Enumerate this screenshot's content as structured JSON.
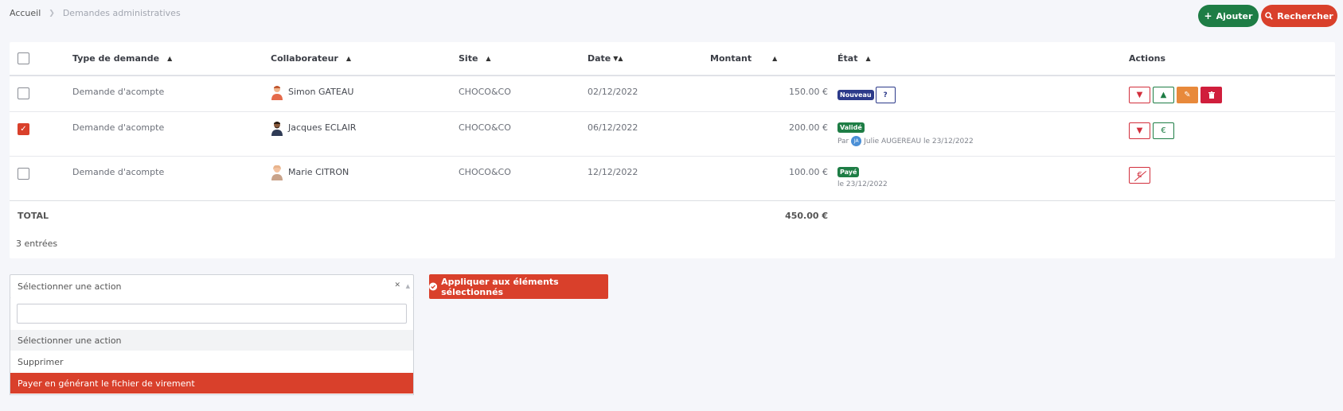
{
  "breadcrumb": {
    "home": "Accueil",
    "current": "Demandes administratives"
  },
  "toolbar": {
    "add_label": "Ajouter",
    "search_label": "Rechercher"
  },
  "table": {
    "headers": {
      "type": "Type de demande",
      "collaborateur": "Collaborateur",
      "site": "Site",
      "date": "Date",
      "montant": "Montant",
      "etat": "État",
      "actions": "Actions"
    },
    "rows": [
      {
        "checked": false,
        "type": "Demande d'acompte",
        "collaborateur": "Simon GATEAU",
        "site": "CHOCO&CO",
        "date": "02/12/2022",
        "montant": "150.00 €",
        "etat_badge": "Nouveau",
        "etat_button": "?",
        "actions": [
          "thumbs-down-icon",
          "thumbs-up-icon",
          "edit-icon",
          "trash-icon"
        ]
      },
      {
        "checked": true,
        "type": "Demande d'acompte",
        "collaborateur": "Jacques ECLAIR",
        "site": "CHOCO&CO",
        "date": "06/12/2022",
        "montant": "200.00 €",
        "etat_badge": "Validé",
        "etat_sub_prefix": "Par",
        "etat_sub_initials": "JA",
        "etat_sub_text": "Julie AUGEREAU le 23/12/2022",
        "pay_label": "€",
        "actions": [
          "thumbs-down-icon",
          "euro-icon"
        ]
      },
      {
        "checked": false,
        "type": "Demande d'acompte",
        "collaborateur": "Marie CITRON",
        "site": "CHOCO&CO",
        "date": "12/12/2022",
        "montant": "100.00 €",
        "etat_badge": "Payé",
        "etat_sub_text": "le 23/12/2022",
        "unpay_label": "€",
        "actions": [
          "euro-strike-icon"
        ]
      }
    ],
    "total_label": "TOTAL",
    "total_value": "450.00 €",
    "entries": "3 entrées"
  },
  "bulk": {
    "select_value": "Sélectionner une action",
    "options": [
      "Sélectionner une action",
      "Supprimer",
      "Payer en générant le fichier de virement"
    ],
    "highlighted_index": 2,
    "apply_label": "Appliquer aux éléments sélectionnés"
  },
  "colors": {
    "primary_red": "#d9402b",
    "green": "#1e7d45",
    "navy": "#2c3a8a",
    "orange": "#e8893b"
  }
}
